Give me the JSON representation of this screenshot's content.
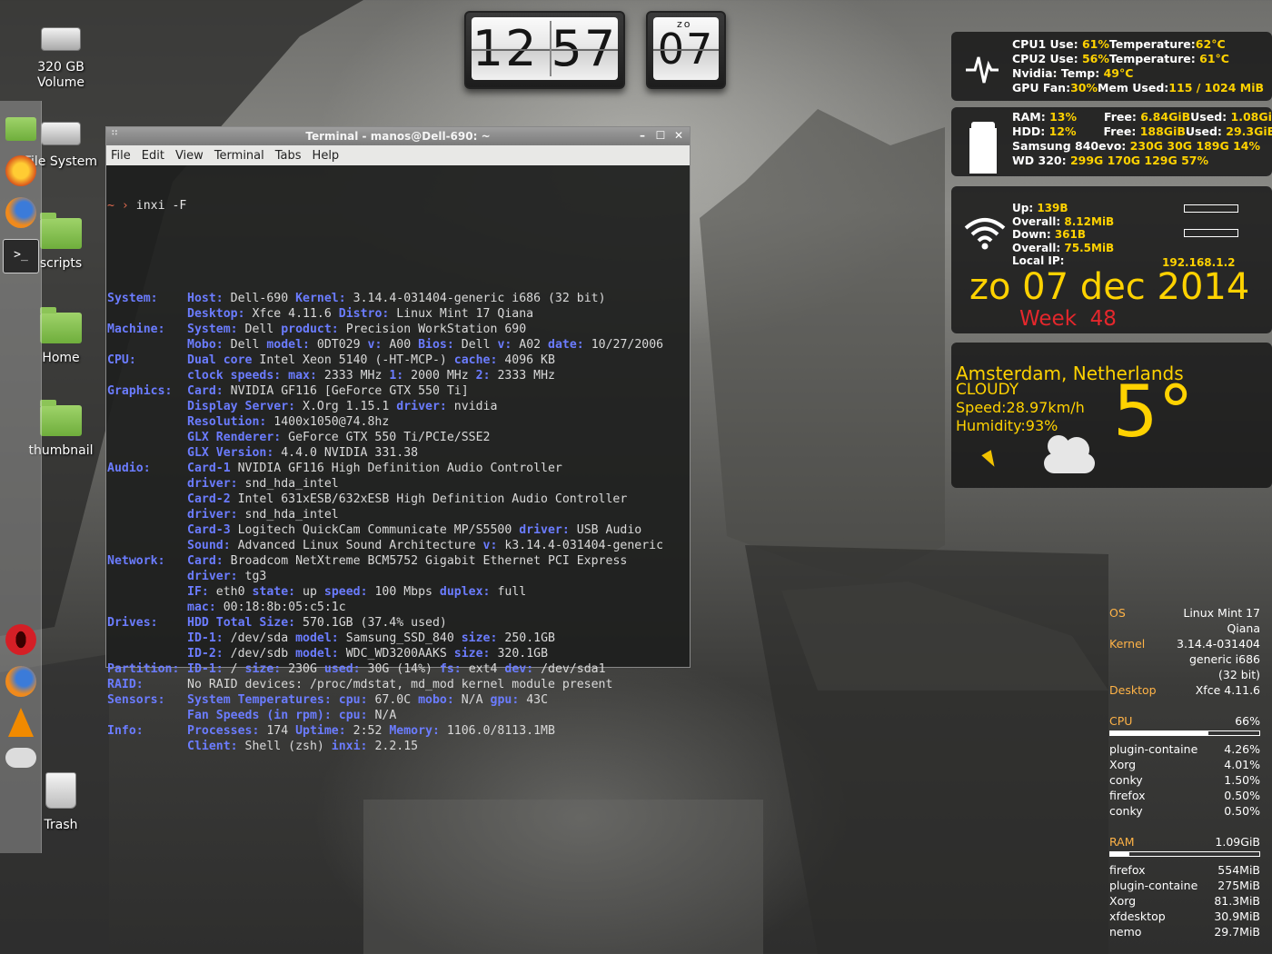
{
  "clock": {
    "hour": "12",
    "minute": "57",
    "day_abbr": "zo",
    "day_num": "07"
  },
  "desktop_icons": [
    {
      "label": "320 GB\nVolume"
    },
    {
      "label": "File System"
    },
    {
      "label": "scripts"
    },
    {
      "label": "Home"
    },
    {
      "label": "thumbnail"
    },
    {
      "label": "Trash"
    }
  ],
  "dock": [
    "folder-icon",
    "crossover-icon",
    "firefox-icon",
    "terminal-icon",
    "opera-icon",
    "firefox-icon",
    "vlc-icon",
    "weather-icon"
  ],
  "terminal": {
    "title": "Terminal - manos@Dell-690: ~",
    "menu": [
      "File",
      "Edit",
      "View",
      "Terminal",
      "Tabs",
      "Help"
    ],
    "prompt": "~ ›",
    "command": "inxi -F",
    "lines": [
      {
        "sec": "System:",
        "parts": [
          [
            "k",
            "Host:"
          ],
          [
            "v",
            " Dell-690 "
          ],
          [
            "k",
            "Kernel:"
          ],
          [
            "v",
            " 3.14.4-031404-generic i686 (32 bit)"
          ]
        ]
      },
      {
        "sec": "",
        "parts": [
          [
            "k",
            "Desktop:"
          ],
          [
            "v",
            " Xfce 4.11.6 "
          ],
          [
            "k",
            "Distro:"
          ],
          [
            "v",
            " Linux Mint 17 Qiana"
          ]
        ]
      },
      {
        "sec": "Machine:",
        "parts": [
          [
            "k",
            "System:"
          ],
          [
            "v",
            " Dell "
          ],
          [
            "k",
            "product:"
          ],
          [
            "v",
            " Precision WorkStation 690"
          ]
        ]
      },
      {
        "sec": "",
        "parts": [
          [
            "k",
            "Mobo:"
          ],
          [
            "v",
            " Dell "
          ],
          [
            "k",
            "model:"
          ],
          [
            "v",
            " 0DT029 "
          ],
          [
            "k",
            "v:"
          ],
          [
            "v",
            " A00 "
          ],
          [
            "k",
            "Bios:"
          ],
          [
            "v",
            " Dell "
          ],
          [
            "k",
            "v:"
          ],
          [
            "v",
            " A02 "
          ],
          [
            "k",
            "date:"
          ],
          [
            "v",
            " 10/27/2006"
          ]
        ]
      },
      {
        "sec": "CPU:",
        "parts": [
          [
            "k",
            "Dual core"
          ],
          [
            "v",
            " Intel Xeon 5140 (-HT-MCP-) "
          ],
          [
            "k",
            "cache:"
          ],
          [
            "v",
            " 4096 KB"
          ]
        ]
      },
      {
        "sec": "",
        "parts": [
          [
            "k",
            "clock speeds:"
          ],
          [
            "v",
            " "
          ],
          [
            "k",
            "max:"
          ],
          [
            "v",
            " 2333 MHz "
          ],
          [
            "k",
            "1:"
          ],
          [
            "v",
            " 2000 MHz "
          ],
          [
            "k",
            "2:"
          ],
          [
            "v",
            " 2333 MHz"
          ]
        ]
      },
      {
        "sec": "Graphics:",
        "parts": [
          [
            "k",
            "Card:"
          ],
          [
            "v",
            " NVIDIA GF116 [GeForce GTX 550 Ti]"
          ]
        ]
      },
      {
        "sec": "",
        "parts": [
          [
            "k",
            "Display Server:"
          ],
          [
            "v",
            " X.Org 1.15.1 "
          ],
          [
            "k",
            "driver:"
          ],
          [
            "v",
            " nvidia"
          ]
        ]
      },
      {
        "sec": "",
        "parts": [
          [
            "k",
            "Resolution:"
          ],
          [
            "v",
            " 1400x1050@74.8hz"
          ]
        ]
      },
      {
        "sec": "",
        "parts": [
          [
            "k",
            "GLX Renderer:"
          ],
          [
            "v",
            " GeForce GTX 550 Ti/PCIe/SSE2"
          ]
        ]
      },
      {
        "sec": "",
        "parts": [
          [
            "k",
            "GLX Version:"
          ],
          [
            "v",
            " 4.4.0 NVIDIA 331.38"
          ]
        ]
      },
      {
        "sec": "Audio:",
        "parts": [
          [
            "k",
            "Card-1"
          ],
          [
            "v",
            " NVIDIA GF116 High Definition Audio Controller"
          ]
        ]
      },
      {
        "sec": "",
        "parts": [
          [
            "k",
            "driver:"
          ],
          [
            "v",
            " snd_hda_intel"
          ]
        ]
      },
      {
        "sec": "",
        "parts": [
          [
            "k",
            "Card-2"
          ],
          [
            "v",
            " Intel 631xESB/632xESB High Definition Audio Controller"
          ]
        ]
      },
      {
        "sec": "",
        "parts": [
          [
            "k",
            "driver:"
          ],
          [
            "v",
            " snd_hda_intel"
          ]
        ]
      },
      {
        "sec": "",
        "parts": [
          [
            "k",
            "Card-3"
          ],
          [
            "v",
            " Logitech QuickCam Communicate MP/S5500 "
          ],
          [
            "k",
            "driver:"
          ],
          [
            "v",
            " USB Audio"
          ]
        ]
      },
      {
        "sec": "",
        "parts": [
          [
            "k",
            "Sound:"
          ],
          [
            "v",
            " Advanced Linux Sound Architecture "
          ],
          [
            "k",
            "v:"
          ],
          [
            "v",
            " k3.14.4-031404-generic"
          ]
        ]
      },
      {
        "sec": "Network:",
        "parts": [
          [
            "k",
            "Card:"
          ],
          [
            "v",
            " Broadcom NetXtreme BCM5752 Gigabit Ethernet PCI Express"
          ]
        ]
      },
      {
        "sec": "",
        "parts": [
          [
            "k",
            "driver:"
          ],
          [
            "v",
            " tg3"
          ]
        ]
      },
      {
        "sec": "",
        "parts": [
          [
            "k",
            "IF:"
          ],
          [
            "v",
            " eth0 "
          ],
          [
            "k",
            "state:"
          ],
          [
            "v",
            " up "
          ],
          [
            "k",
            "speed:"
          ],
          [
            "v",
            " 100 Mbps "
          ],
          [
            "k",
            "duplex:"
          ],
          [
            "v",
            " full"
          ]
        ]
      },
      {
        "sec": "",
        "parts": [
          [
            "k",
            "mac:"
          ],
          [
            "v",
            " 00:18:8b:05:c5:1c"
          ]
        ]
      },
      {
        "sec": "Drives:",
        "parts": [
          [
            "k",
            "HDD Total Size:"
          ],
          [
            "v",
            " 570.1GB (37.4% used)"
          ]
        ]
      },
      {
        "sec": "",
        "parts": [
          [
            "k",
            "ID-1:"
          ],
          [
            "v",
            " /dev/sda "
          ],
          [
            "k",
            "model:"
          ],
          [
            "v",
            " Samsung_SSD_840 "
          ],
          [
            "k",
            "size:"
          ],
          [
            "v",
            " 250.1GB"
          ]
        ]
      },
      {
        "sec": "",
        "parts": [
          [
            "k",
            "ID-2:"
          ],
          [
            "v",
            " /dev/sdb "
          ],
          [
            "k",
            "model:"
          ],
          [
            "v",
            " WDC_WD3200AAKS "
          ],
          [
            "k",
            "size:"
          ],
          [
            "v",
            " 320.1GB"
          ]
        ]
      },
      {
        "sec": "Partition:",
        "parts": [
          [
            "k",
            "ID-1:"
          ],
          [
            "v",
            " / "
          ],
          [
            "k",
            "size:"
          ],
          [
            "v",
            " 230G "
          ],
          [
            "k",
            "used:"
          ],
          [
            "v",
            " 30G (14%) "
          ],
          [
            "k",
            "fs:"
          ],
          [
            "v",
            " ext4 "
          ],
          [
            "k",
            "dev:"
          ],
          [
            "v",
            " /dev/sda1"
          ]
        ]
      },
      {
        "sec": "RAID:",
        "parts": [
          [
            "v",
            "No RAID devices: /proc/mdstat, md_mod kernel module present"
          ]
        ]
      },
      {
        "sec": "Sensors:",
        "parts": [
          [
            "k",
            "System Temperatures:"
          ],
          [
            "v",
            " "
          ],
          [
            "k",
            "cpu:"
          ],
          [
            "v",
            " 67.0C "
          ],
          [
            "k",
            "mobo:"
          ],
          [
            "v",
            " N/A "
          ],
          [
            "k",
            "gpu:"
          ],
          [
            "v",
            " 43C"
          ]
        ]
      },
      {
        "sec": "",
        "parts": [
          [
            "k",
            "Fan Speeds (in rpm):"
          ],
          [
            "v",
            " "
          ],
          [
            "k",
            "cpu:"
          ],
          [
            "v",
            " N/A"
          ]
        ]
      },
      {
        "sec": "Info:",
        "parts": [
          [
            "k",
            "Processes:"
          ],
          [
            "v",
            " 174 "
          ],
          [
            "k",
            "Uptime:"
          ],
          [
            "v",
            " 2:52 "
          ],
          [
            "k",
            "Memory:"
          ],
          [
            "v",
            " 1106.0/8113.1MB"
          ]
        ]
      },
      {
        "sec": "",
        "parts": [
          [
            "k",
            "Client:"
          ],
          [
            "v",
            " Shell (zsh) "
          ],
          [
            "k",
            "inxi:"
          ],
          [
            "v",
            " 2.2.15"
          ]
        ]
      }
    ]
  },
  "conky_cpu": {
    "l1a": "CPU1  Use: ",
    "l1b": "61%",
    "l1c": "Temperature:",
    "l1d": "62°C",
    "l2a": "CPU2  Use: ",
    "l2b": "56%",
    "l2c": "Temperature: ",
    "l2d": "61°C",
    "l3a": "Nvidia:  Temp: ",
    "l3b": "49°C",
    "l4a": "GPU Fan:",
    "l4b": "30%",
    "l4c": "Mem Used:",
    "l4d": "115 / 1024 MiB"
  },
  "conky_mem": {
    "ram_label": "RAM: ",
    "ram_pct": "13%",
    "ram_free_l": "Free: ",
    "ram_free": "6.84GiB",
    "ram_used_l": "Used: ",
    "ram_used": "1.08GiB",
    "hdd_label": "HDD: ",
    "hdd_pct": "12%",
    "hdd_free_l": "Free: ",
    "hdd_free": "188GiB",
    "hdd_used_l": "Used: ",
    "hdd_used": "29.3GiB",
    "ssd_label": "Samsung 840evo: ",
    "ssd_vals": "230G  30G  189G  14%",
    "wd_label": "WD 320: ",
    "wd_vals": "299G  170G  129G  57%"
  },
  "conky_net": {
    "up_l": "Up: ",
    "up": "139B",
    "overall1_l": "Overall: ",
    "overall1": "8.12MiB",
    "down_l": "Down: ",
    "down": "361B",
    "overall2_l": "Overall: ",
    "overall2": "75.5MiB",
    "ip_l": "Local IP:",
    "ip": "192.168.1.2",
    "date": "zo 07 dec 2014",
    "week": "Week  48"
  },
  "weather": {
    "city": "Amsterdam, Netherlands",
    "cond": "CLOUDY",
    "speed": "Speed:28.97km/h",
    "humidity": "Humidity:93%",
    "temp": "5°"
  },
  "sysinfo": {
    "os_l": "OS",
    "os": "Linux Mint 17\nQiana",
    "kernel_l": "Kernel",
    "kernel": "3.14.4-031404\ngeneric i686\n(32 bit)",
    "desktop_l": "Desktop",
    "desktop": "Xfce 4.11.6",
    "cpu_l": "CPU",
    "cpu": "66%",
    "cpu_fill": 0.66,
    "cpu_procs": [
      [
        "plugin-containe",
        "4.26%"
      ],
      [
        "Xorg",
        "4.01%"
      ],
      [
        "conky",
        "1.50%"
      ],
      [
        "firefox",
        "0.50%"
      ],
      [
        "conky",
        "0.50%"
      ]
    ],
    "ram_l": "RAM",
    "ram": "1.09GiB",
    "ram_fill": 0.13,
    "ram_procs": [
      [
        "firefox",
        "554MiB"
      ],
      [
        "plugin-containe",
        "275MiB"
      ],
      [
        "Xorg",
        "81.3MiB"
      ],
      [
        "xfdesktop",
        "30.9MiB"
      ],
      [
        "nemo",
        "29.7MiB"
      ]
    ]
  }
}
